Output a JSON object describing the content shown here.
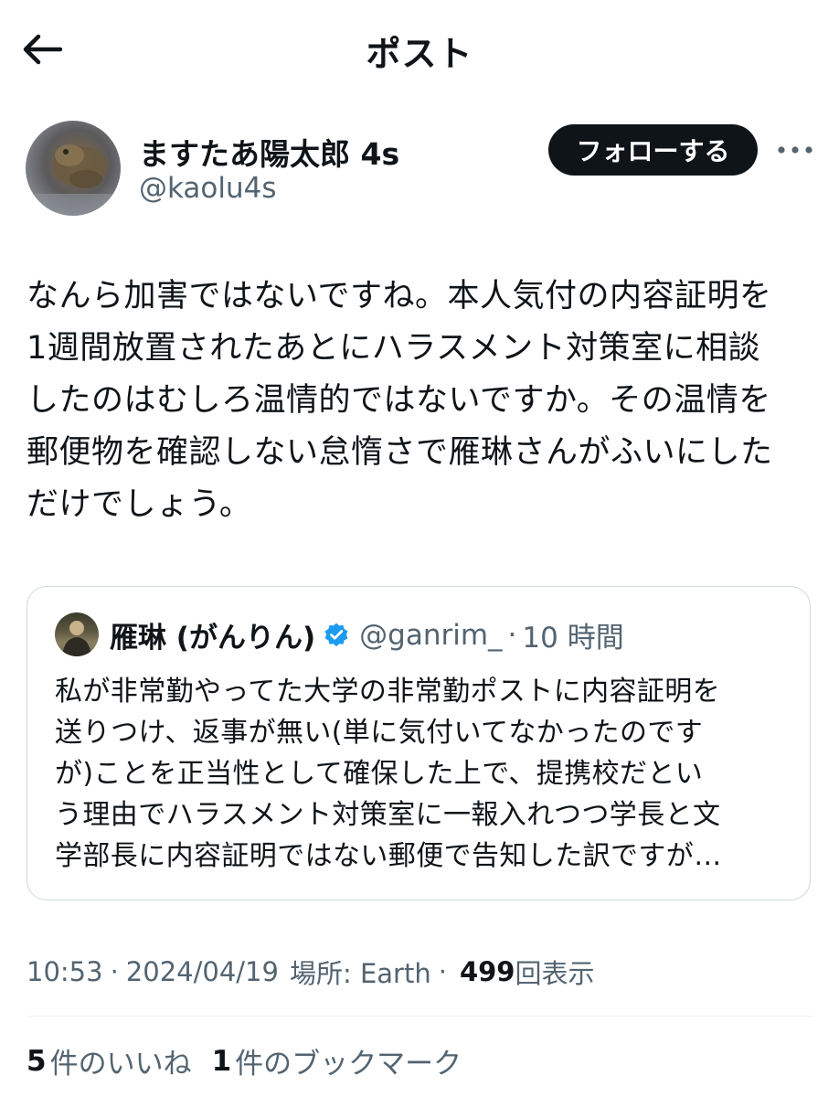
{
  "header": {
    "title": "ポスト"
  },
  "author": {
    "name": "ますたあ陽太郎 4s",
    "handle": "@kaolu4s",
    "follow_label": "フォローする"
  },
  "post": {
    "lines": [
      "なんら加害ではないですね。本人気付の内容証明を",
      "1週間放置されたあとにハラスメント対策室に相談",
      "したのはむしろ温情的ではないですか。その温情を",
      "郵便物を確認しない怠惰さで雁琳さんがふいにした",
      "だけでしょう。"
    ]
  },
  "quote": {
    "name": "雁琳 (がんりん)",
    "handle": "@ganrim_",
    "dot": "·",
    "time": "10 時間",
    "lines": [
      "私が非常勤やってた大学の非常勤ポストに内容証明を",
      "送りつけ、返事が無い(単に気付いてなかったのです",
      "が)ことを正当性として確保した上で、提携校だとい",
      "う理由でハラスメント対策室に一報入れつつ学長と文",
      "学部長に内容証明ではない郵便で告知した訳ですが…"
    ]
  },
  "meta": {
    "time": "10:53",
    "dot1": "·",
    "date": "2024/04/19",
    "location": "場所: Earth",
    "dot2": "·",
    "views_count": "499",
    "views_label": "回表示"
  },
  "stats": {
    "likes_count": "5",
    "likes_label": "件のいいね",
    "bookmarks_count": "1",
    "bookmarks_label": "件のブックマーク"
  },
  "colors": {
    "text": "#0f1419",
    "secondary": "#536471",
    "border": "#cfd9de",
    "verified": "#1d9bf0"
  }
}
